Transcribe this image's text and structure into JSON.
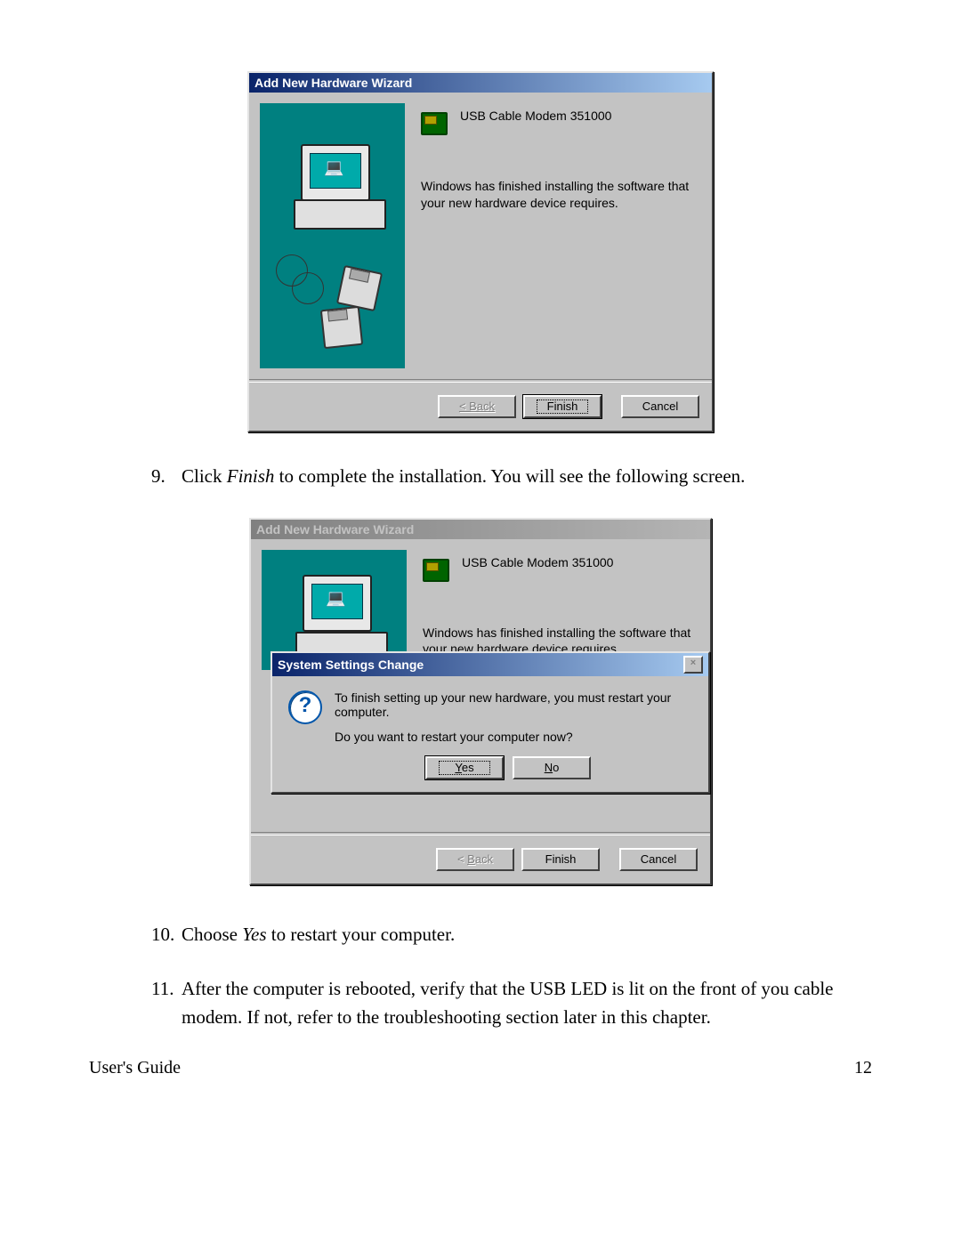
{
  "doc": {
    "step9_a": "Click ",
    "step9_i": "Finish",
    "step9_b": " to complete the installation.  You will see the following screen.",
    "step10_a": "Choose ",
    "step10_i": "Yes",
    "step10_b": " to restart your computer.",
    "step11": "After the computer is rebooted, verify that the USB LED is lit on the front of you cable modem.  If not, refer to the troubleshooting section later in this chapter.",
    "footer_left": "User's Guide",
    "footer_right": "12"
  },
  "wizard1": {
    "title": "Add New Hardware Wizard",
    "device": "USB Cable Modem 351000",
    "finished": "Windows has finished installing the software that your new hardware device requires.",
    "back": "< Back",
    "finish": "Finish",
    "cancel": "Cancel"
  },
  "wizard2": {
    "title": "Add New Hardware Wizard",
    "device": "USB Cable Modem 351000",
    "finished": "Windows has finished installing the software that your new hardware device requires.",
    "back": "< Back",
    "finish": "Finish",
    "cancel": "Cancel"
  },
  "ssc": {
    "title": "System Settings Change",
    "line1": "To finish setting up your new hardware, you must restart your computer.",
    "line2": "Do you want to restart your computer now?",
    "yes": "Yes",
    "no": "No"
  }
}
